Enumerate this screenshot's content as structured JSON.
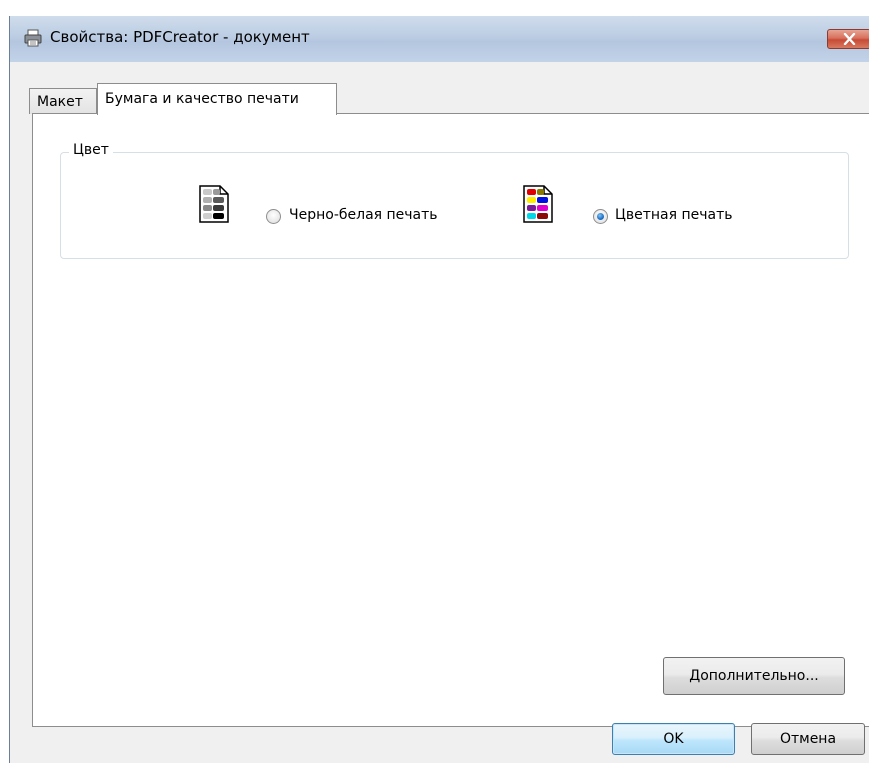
{
  "window": {
    "title": "Свойства: PDFCreator - документ"
  },
  "tabs": [
    {
      "label": "Макет",
      "active": false
    },
    {
      "label": "Бумага и качество печати",
      "active": true
    }
  ],
  "color_group": {
    "legend": "Цвет",
    "options": [
      {
        "label": "Черно-белая печать",
        "selected": false,
        "icon": "grayscale-document-icon"
      },
      {
        "label": "Цветная печать",
        "selected": true,
        "icon": "color-document-icon"
      }
    ]
  },
  "buttons": {
    "advanced": "Дополнительно...",
    "ok": "OK",
    "cancel": "Отмена"
  },
  "colors": {
    "titlebar": "#bccde3",
    "dialog_bg": "#f0f0f0",
    "close_button": "#c74a35",
    "radio_selected": "#1e6fc5"
  }
}
